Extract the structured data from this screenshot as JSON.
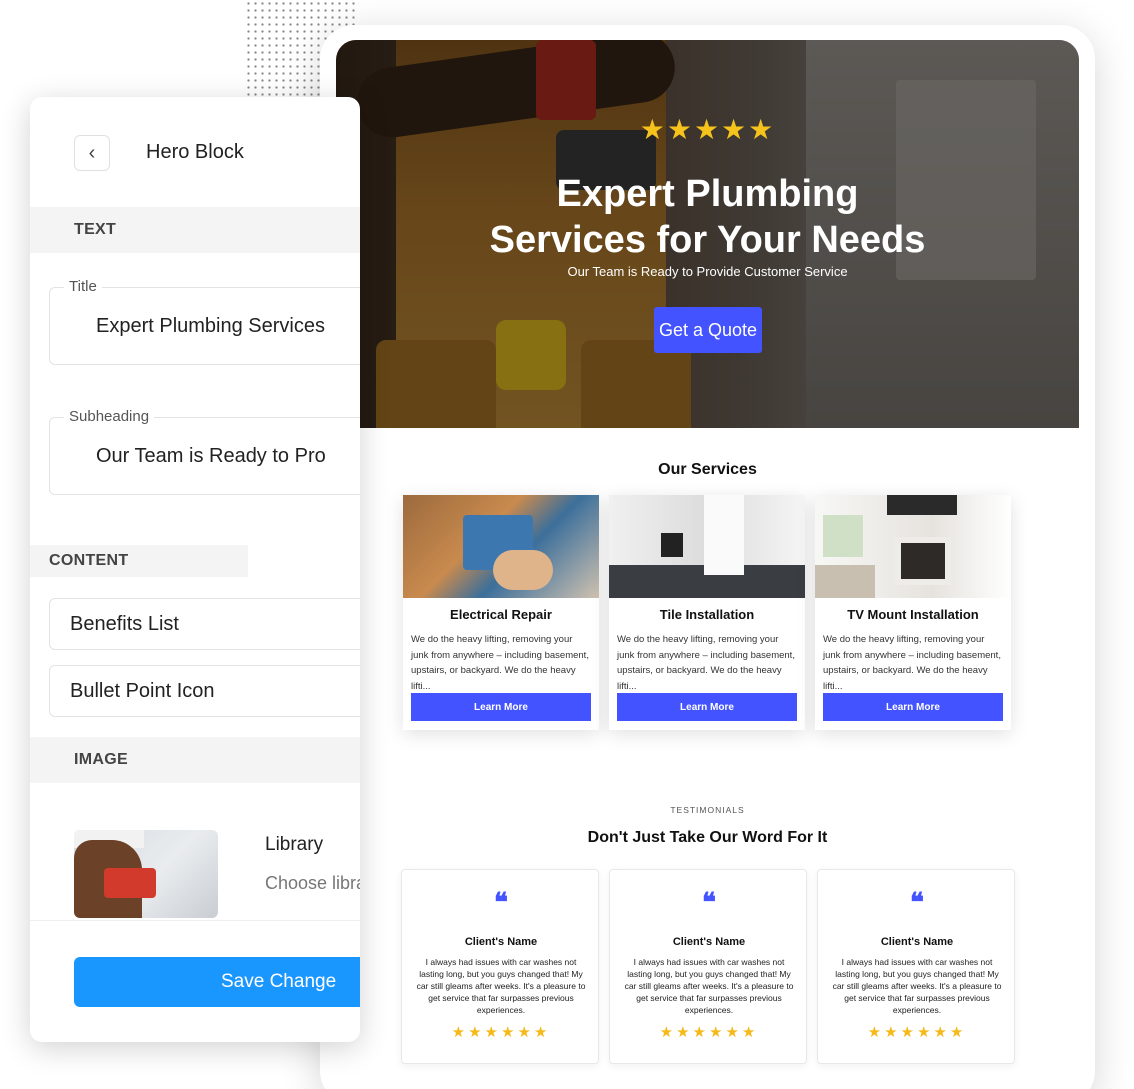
{
  "editor": {
    "title": "Hero Block",
    "back_icon": "chevron-left-icon",
    "sections": {
      "text": "TEXT",
      "content": "CONTENT",
      "image": "IMAGE"
    },
    "fields": {
      "title_label": "Title",
      "title_value": "Expert Plumbing Services",
      "subheading_label": "Subheading",
      "subheading_value": "Our Team is Ready to Pro"
    },
    "content_items": [
      "Benefits List",
      "Bullet Point Icon"
    ],
    "image": {
      "library_title": "Library",
      "library_desc": "Choose library"
    },
    "save_label": "Save Change"
  },
  "preview": {
    "hero": {
      "stars": "★★★★★",
      "title": "Expert Plumbing Services for Your Needs",
      "subtitle": "Our Team is Ready to Provide Customer Service",
      "cta": "Get a Quote"
    },
    "services": {
      "heading": "Our Services",
      "items": [
        {
          "name": "Electrical Repair",
          "desc": "We do the heavy lifting, removing your junk from anywhere – including basement, upstairs, or backyard. We do the heavy lifti...",
          "button": "Learn More"
        },
        {
          "name": "Tile Installation",
          "desc": "We do the heavy lifting, removing your junk from anywhere – including basement, upstairs, or backyard. We do the heavy lifti...",
          "button": "Learn More"
        },
        {
          "name": "TV Mount Installation",
          "desc": "We do the heavy lifting, removing your junk from anywhere – including basement, upstairs, or backyard. We do the heavy lifti...",
          "button": "Learn More"
        }
      ]
    },
    "testimonials": {
      "kicker": "TESTIMONIALS",
      "heading": "Don't Just Take Our Word For It",
      "items": [
        {
          "quote_mark": "❝",
          "name": "Client's Name",
          "text": "I always had issues with car washes not lasting long, but you guys changed that! My car still gleams after weeks. It's a pleasure to get service that far surpasses previous experiences.",
          "stars": "★★★★★★"
        },
        {
          "quote_mark": "❝",
          "name": "Client's Name",
          "text": "I always had issues with car washes not lasting long, but you guys changed that! My car still gleams after weeks. It's a pleasure to get service that far surpasses previous experiences.",
          "stars": "★★★★★★"
        },
        {
          "quote_mark": "❝",
          "name": "Client's Name",
          "text": "I always had issues with car washes not lasting long, but you guys changed that! My car still gleams after weeks. It's a pleasure to get service that far surpasses previous experiences.",
          "stars": "★★★★★★"
        }
      ]
    }
  },
  "colors": {
    "accent": "#4353ff",
    "save_button": "#1a96ff",
    "star": "#f6c21c"
  }
}
